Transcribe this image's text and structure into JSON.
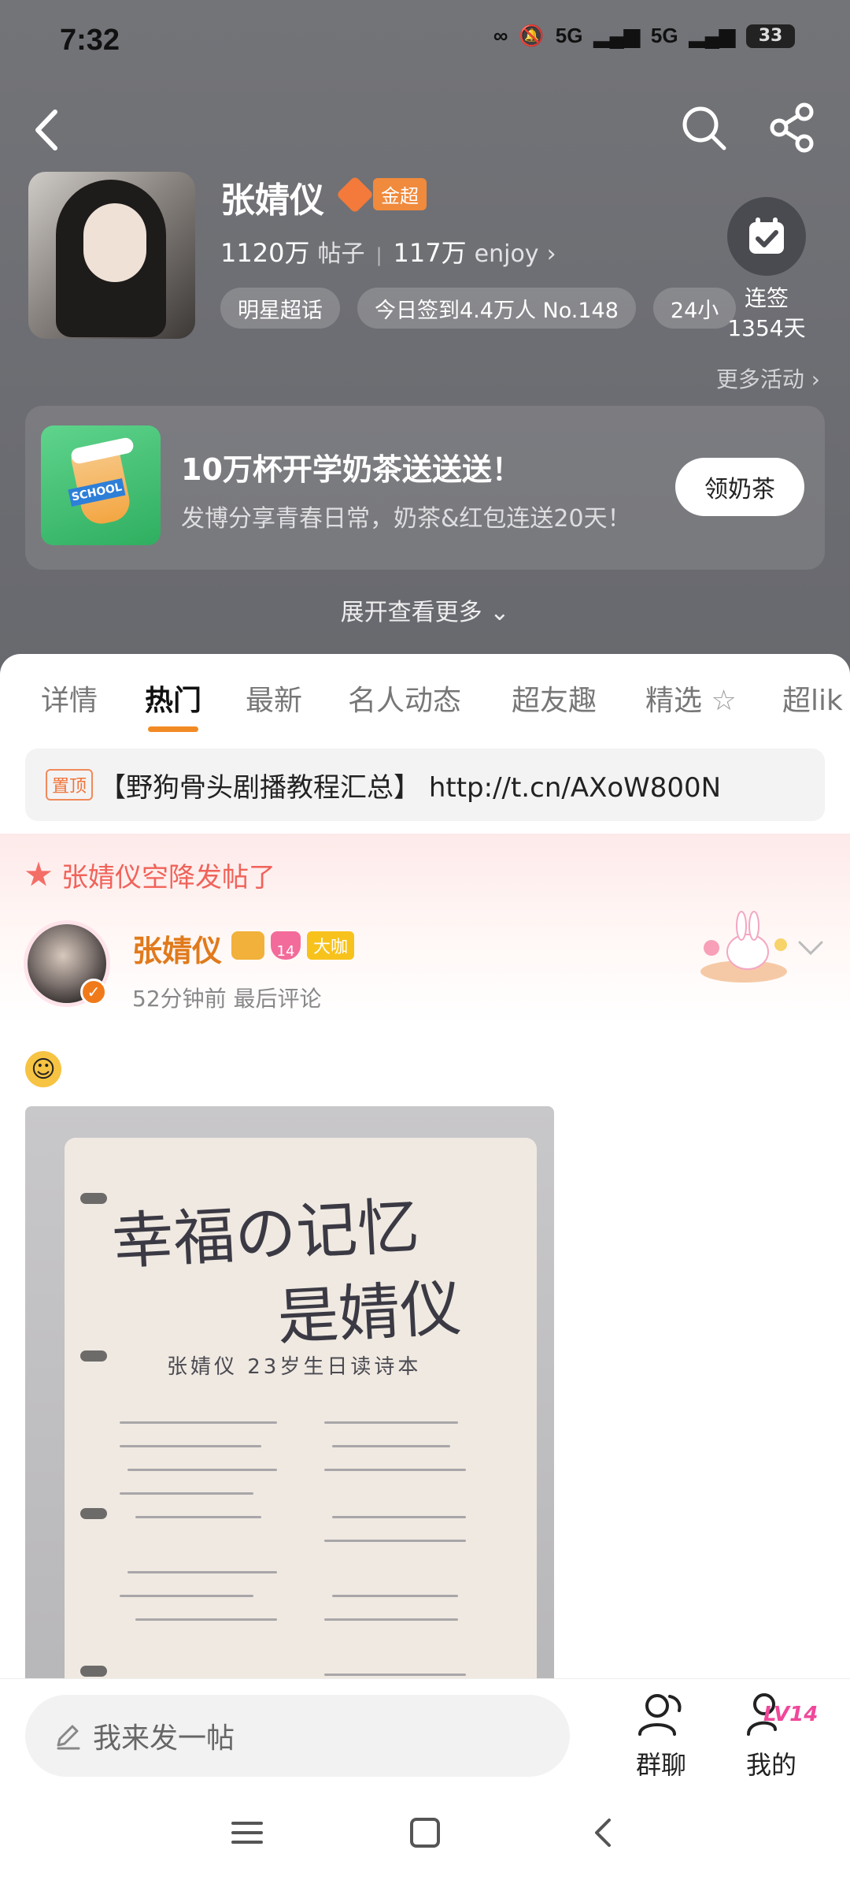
{
  "status_bar": {
    "time": "7:32",
    "signal1": "5G",
    "signal2": "5G",
    "battery": "33"
  },
  "profile": {
    "name": "张婧仪",
    "badge": "金超",
    "posts_count": "1120万",
    "posts_label": "帖子",
    "enjoy_count": "117万",
    "enjoy_label": "enjoy",
    "chips": [
      "明星超话",
      "今日签到4.4万人 No.148",
      "24小"
    ],
    "checkin_label": "连签",
    "checkin_days": "1354天",
    "more_activity": "更多活动"
  },
  "promo": {
    "title": "10万杯开学奶茶送送送！",
    "subtitle": "发博分享青春日常，奶茶&红包连送20天！",
    "button": "领奶茶",
    "image_text": "SCHOOL"
  },
  "expand_label": "展开查看更多",
  "tabs": [
    "详情",
    "热门",
    "最新",
    "名人动态",
    "超友趣",
    "精选",
    "超lik"
  ],
  "active_tab": "热门",
  "pinned": {
    "tag": "置顶",
    "text": "【野狗骨头剧播教程汇总】 http://t.cn/AXoW800N"
  },
  "post": {
    "airdrop": "张婧仪空降发帖了",
    "author": "张婧仪",
    "level_badge": "14",
    "tag": "大咖",
    "meta": "52分钟前  最后评论",
    "emoji": "☺",
    "photo_title_1": "幸福の记忆",
    "photo_title_2": "是婧仪",
    "photo_subtitle": "张婧仪 23岁生日读诗本"
  },
  "bottom_bar": {
    "compose": "我来发一帖",
    "group": "群聊",
    "me": "我的",
    "me_level": "LV14"
  }
}
